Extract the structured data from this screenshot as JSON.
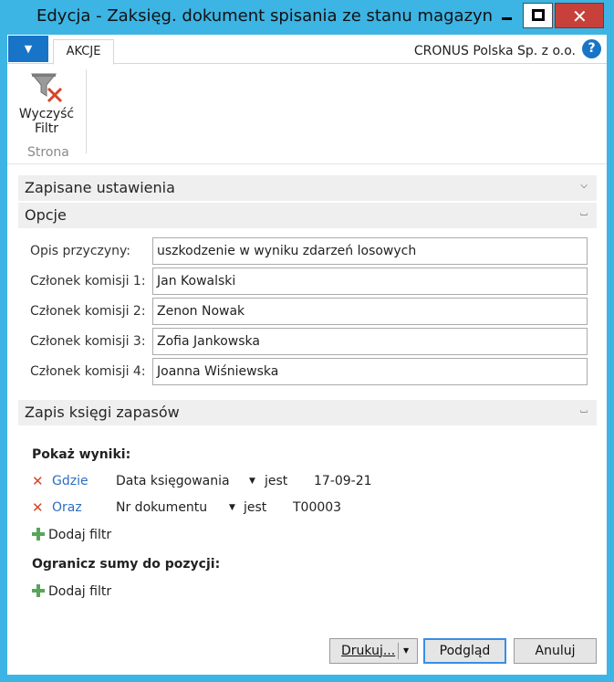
{
  "window": {
    "title": "Edycja - Zaksięg. dokument spisania ze stanu magazynu",
    "accent": "#3cb4e4",
    "close_color": "#c7403a"
  },
  "ribbon": {
    "app_menu_glyph": "▼",
    "tab_label": "AKCJE",
    "company": "CRONUS Polska Sp. z o.o.",
    "help_glyph": "?",
    "clear_filter_label_line1": "Wyczyść",
    "clear_filter_label_line2": "Filtr",
    "clear_filter_icon": "clear-filter-icon",
    "group_label": "Strona"
  },
  "sections": {
    "saved_settings": "Zapisane ustawienia",
    "options": "Opcje",
    "item_ledger": "Zapis księgi zapasów",
    "chevron_down": "˅",
    "chevron_up": "˄"
  },
  "options": {
    "fields": [
      {
        "label": "Opis przyczyny:",
        "value": "uszkodzenie w wyniku zdarzeń losowych"
      },
      {
        "label": "Członek komisji 1:",
        "value": "Jan Kowalski"
      },
      {
        "label": "Członek komisji 2:",
        "value": "Zenon Nowak"
      },
      {
        "label": "Członek komisji 3:",
        "value": "Zofia Jankowska"
      },
      {
        "label": "Członek komisji 4:",
        "value": "Joanna Wiśniewska"
      }
    ]
  },
  "filters": {
    "show_results_label": "Pokaż wyniki:",
    "rows": [
      {
        "delete_glyph": "✕",
        "conj": "Gdzie",
        "field": "Data księgowania",
        "op": "jest",
        "value": "17-09-21"
      },
      {
        "delete_glyph": "✕",
        "conj": "Oraz",
        "field": "Nr dokumentu",
        "op": "jest",
        "value": "T00003"
      }
    ],
    "dropdown_glyph": "▼",
    "add_filter_label": "Dodaj filtr",
    "limit_totals_label": "Ogranicz sumy do pozycji:",
    "add_filter_label_2": "Dodaj filtr"
  },
  "buttons": {
    "print": "Drukuj...",
    "print_dropdown_glyph": "▼",
    "preview": "Podgląd",
    "cancel": "Anuluj"
  }
}
